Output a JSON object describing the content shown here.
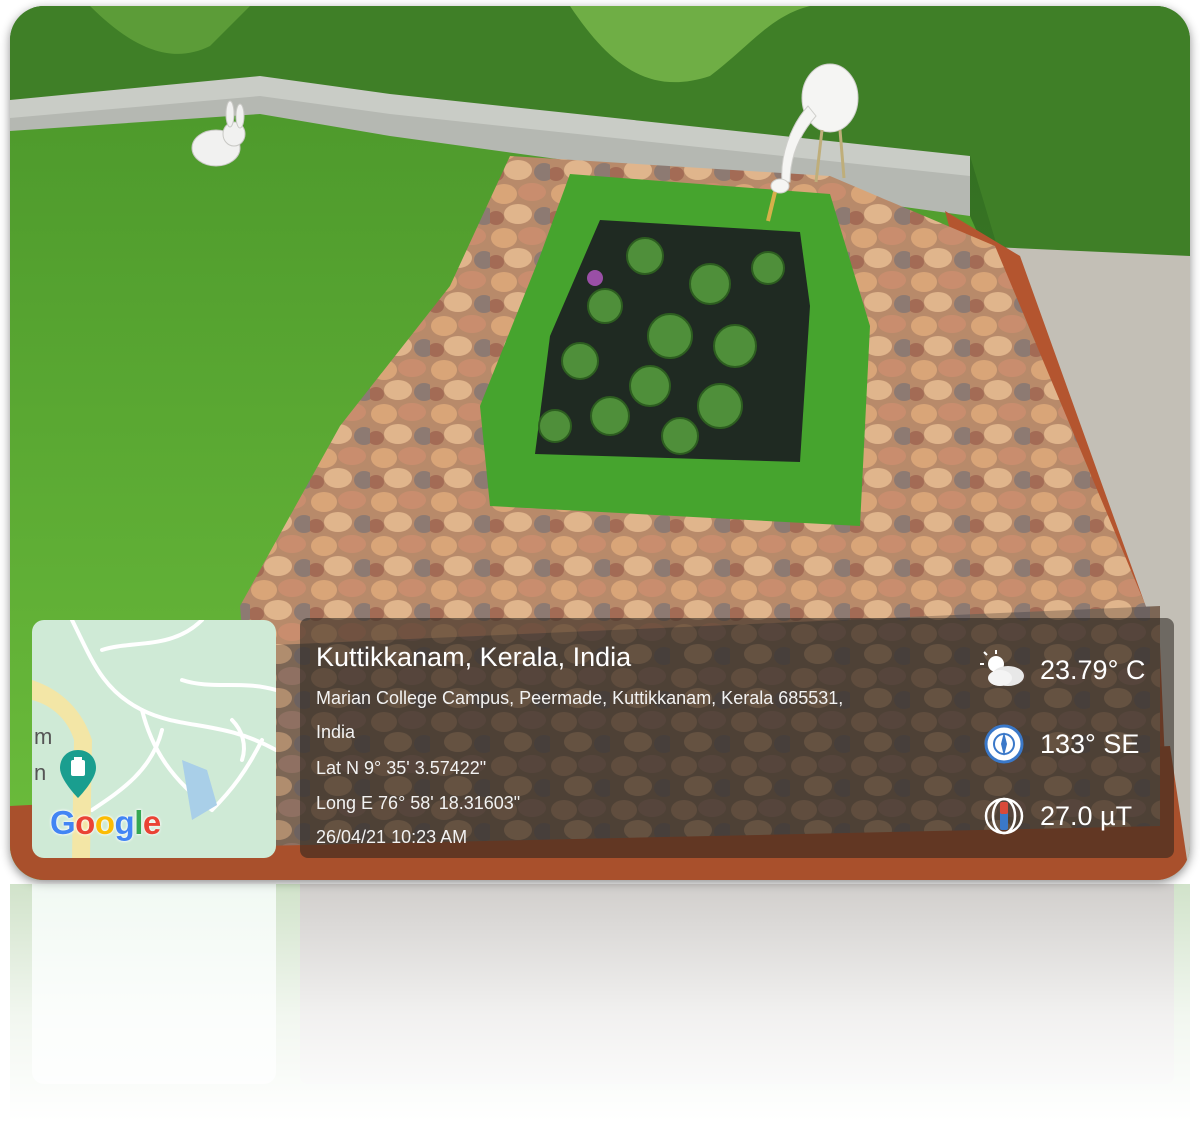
{
  "location": {
    "title": "Kuttikkanam, Kerala, India",
    "address_line1": "Marian College Campus, Peermade, Kuttikkanam, Kerala 685531,",
    "address_line2": "India",
    "latitude": "Lat N 9° 35' 3.57422\"",
    "longitude": "Long E 76° 58' 18.31603\"",
    "datetime": "26/04/21 10:23 AM"
  },
  "readings": {
    "temperature": "23.79° C",
    "compass": "133° SE",
    "magnetic": "27.0 µT"
  },
  "map": {
    "logo": "Google",
    "label_top": "m",
    "label_bottom": "n",
    "pin_icon": "map-pin-icon"
  },
  "icons": {
    "weather": "partly-cloudy-icon",
    "compass": "compass-icon",
    "magnet": "magnetic-field-icon"
  },
  "colors": {
    "grass": "#5aa632",
    "water": "#1f2a22",
    "panel": "#28221e",
    "map_bg": "#cfead6",
    "pin": "#1a9e8f"
  }
}
